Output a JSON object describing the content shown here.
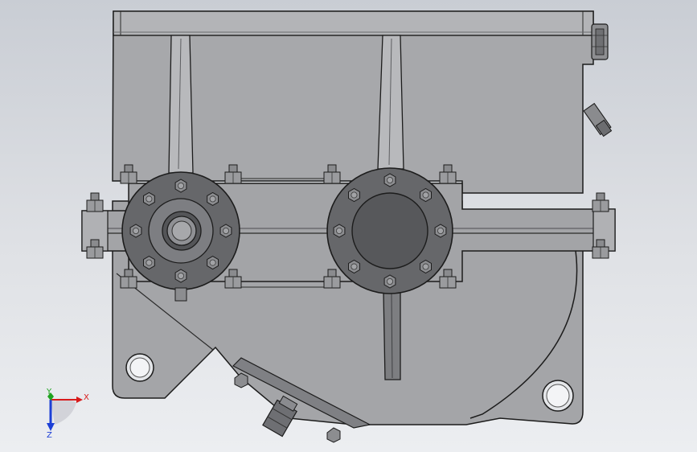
{
  "view": {
    "triad": {
      "x_label": "X",
      "y_label": "Y",
      "z_label": "Z",
      "x_color": "#d81b1b",
      "y_color": "#1fa31f",
      "z_color": "#1c3fd6"
    }
  },
  "colors": {
    "background_top": "#c9cdd4",
    "background_bottom": "#eceef1",
    "housing_body": "#a9aaad",
    "housing_face": "#9c9da0",
    "outline": "#1c1c1c",
    "flange": "#66676a",
    "flange_dark": "#545558",
    "bolt": "#8c8d90"
  }
}
